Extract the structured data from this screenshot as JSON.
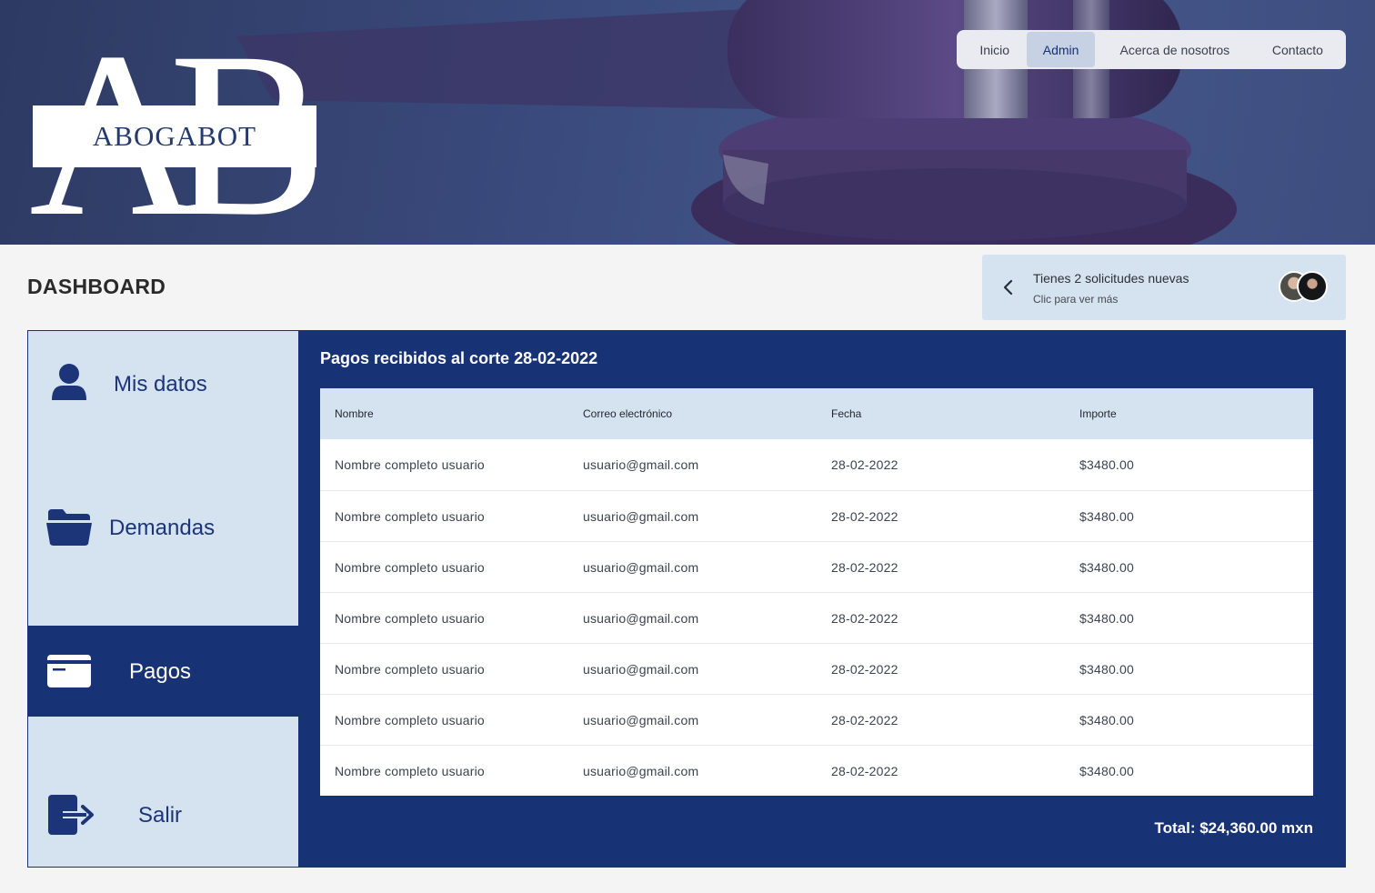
{
  "header": {
    "logo_mark": "AB",
    "brand_name": "ABOGABOT",
    "nav": [
      {
        "label": "Inicio",
        "active": false
      },
      {
        "label": "Admin",
        "active": true
      },
      {
        "label": "Acerca de nosotros",
        "active": false
      },
      {
        "label": "Contacto",
        "active": false
      }
    ]
  },
  "page": {
    "title": "DASHBOARD"
  },
  "notification": {
    "title": "Tienes 2 solicitudes nuevas",
    "subtitle": "Clic para ver más",
    "icons": [
      "chevron-left-icon",
      "avatar-1",
      "avatar-2"
    ]
  },
  "sidebar": {
    "items": [
      {
        "label": "Mis datos",
        "icon": "user-icon",
        "active": false
      },
      {
        "label": "Demandas",
        "icon": "folder-icon",
        "active": false
      },
      {
        "label": "Pagos",
        "icon": "credit-card-icon",
        "active": true
      },
      {
        "label": "Salir",
        "icon": "sign-out-icon",
        "active": false
      }
    ]
  },
  "payments": {
    "title": "Pagos recibidos al corte 28-02-2022",
    "columns": [
      "Nombre",
      "Correo electrónico",
      "Fecha",
      "Importe"
    ],
    "rows": [
      [
        "Nombre completo usuario",
        "usuario@gmail.com",
        "28-02-2022",
        "$3480.00"
      ],
      [
        "Nombre completo usuario",
        "usuario@gmail.com",
        "28-02-2022",
        "$3480.00"
      ],
      [
        "Nombre completo usuario",
        "usuario@gmail.com",
        "28-02-2022",
        "$3480.00"
      ],
      [
        "Nombre completo usuario",
        "usuario@gmail.com",
        "28-02-2022",
        "$3480.00"
      ],
      [
        "Nombre completo usuario",
        "usuario@gmail.com",
        "28-02-2022",
        "$3480.00"
      ],
      [
        "Nombre completo usuario",
        "usuario@gmail.com",
        "28-02-2022",
        "$3480.00"
      ],
      [
        "Nombre completo usuario",
        "usuario@gmail.com",
        "28-02-2022",
        "$3480.00"
      ]
    ],
    "total": "Total: $24,360.00 mxn"
  },
  "colors": {
    "primary": "#183375",
    "light_panel": "#d5e2ef",
    "page_bg": "#f4f4f4",
    "nav_active": "#c6d2e4"
  }
}
